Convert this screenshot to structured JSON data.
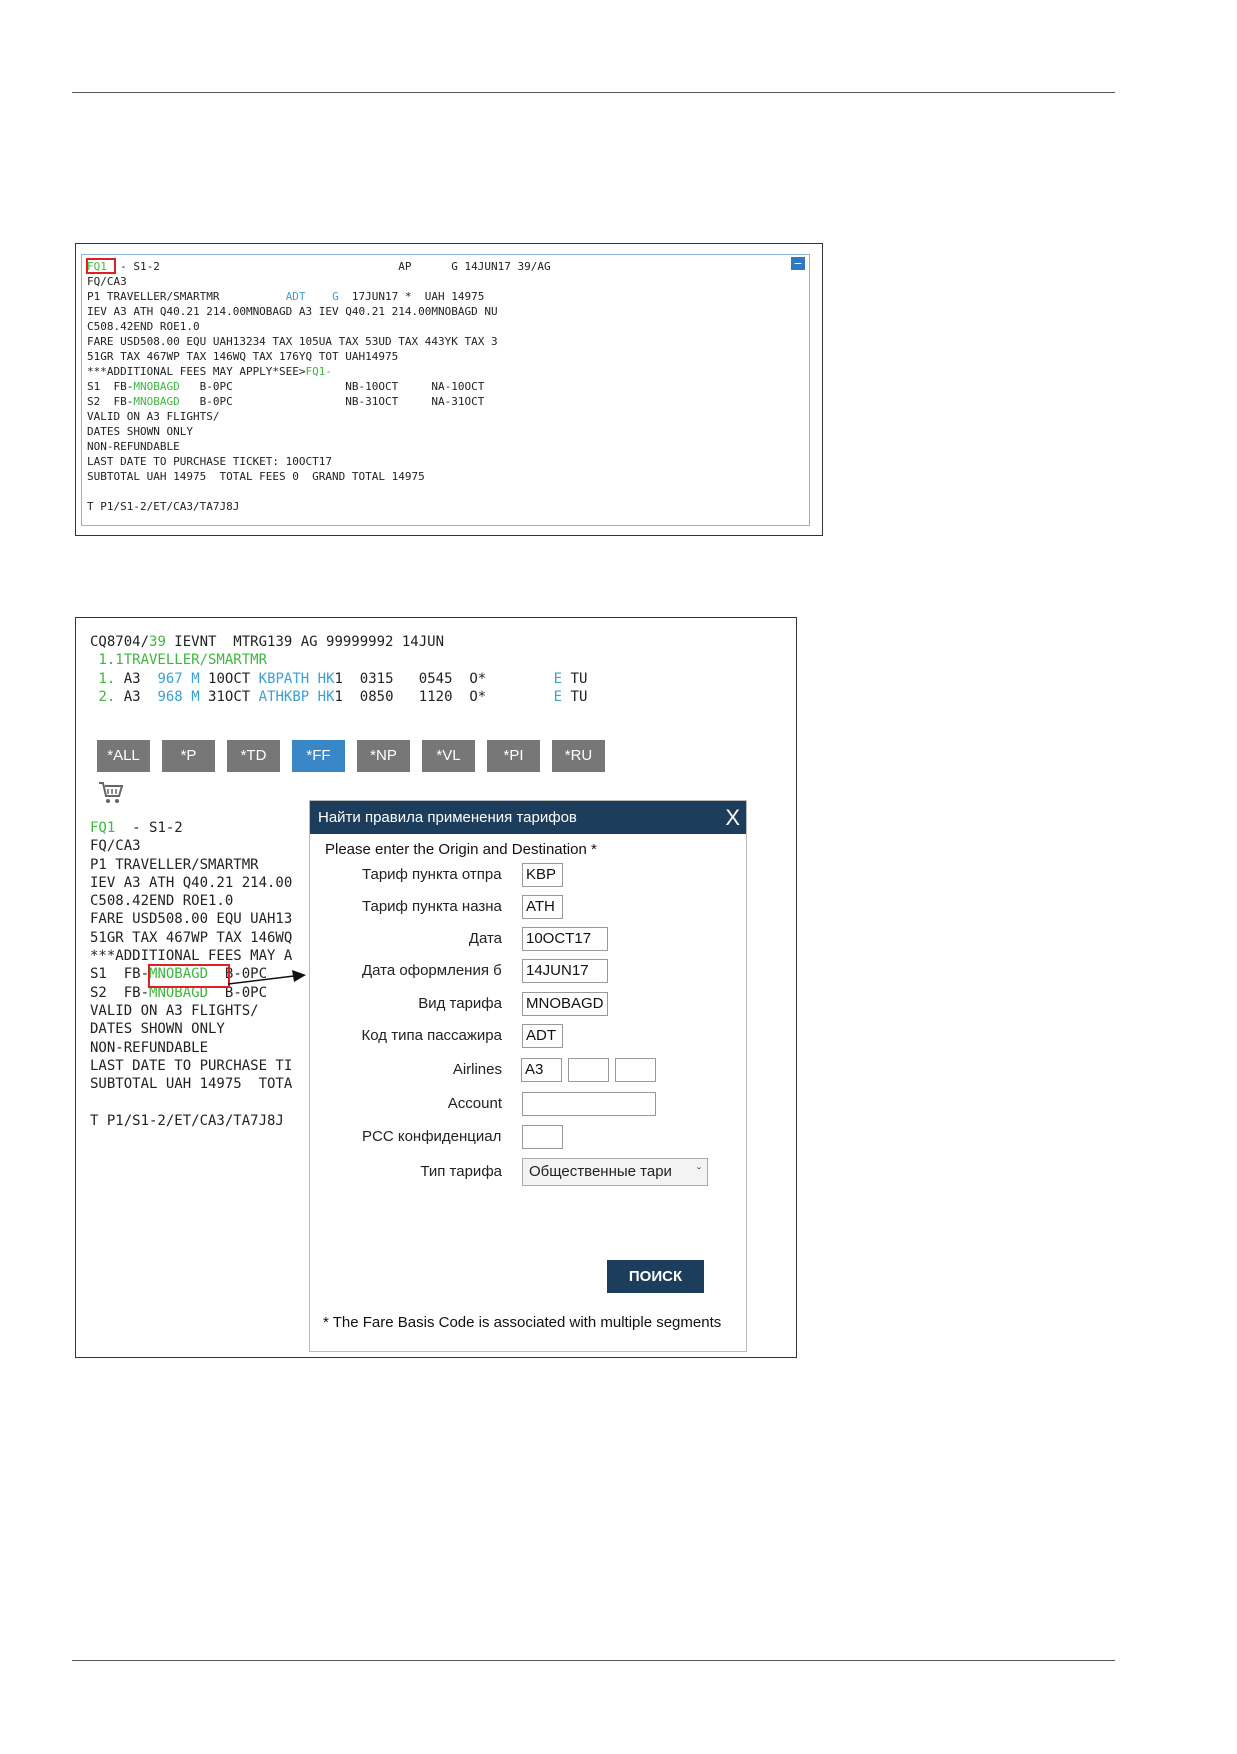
{
  "screen1": {
    "header": {
      "fq": "FQ1",
      "rest": "  - S1-2                                    AP      G 14JUN17 39/AG"
    },
    "collapse_icon": "−",
    "line2": "FQ/CA3",
    "line3": {
      "a": "P1 TRAVELLER/SMARTMR          ",
      "adt": "ADT",
      "sp": "    ",
      "g": "G",
      "rest": "  17JUN17 *  UAH 14975"
    },
    "line4": "IEV A3 ATH Q40.21 214.00MNOBAGD A3 IEV Q40.21 214.00MNOBAGD NU",
    "line5": "C508.42END ROE1.0",
    "line6": "FARE USD508.00 EQU UAH13234 TAX 105UA TAX 53UD TAX 443YK TAX 3",
    "line7": "51GR TAX 467WP TAX 146WQ TAX 176YQ TOT UAH14975",
    "line8": {
      "a": "***ADDITIONAL FEES MAY APPLY*SEE>",
      "link": "FQ1-"
    },
    "line9": {
      "a": "S1  FB-",
      "fb": "MNOBAGD",
      "b": "   B-0PC                 NB-10OCT     NA-10OCT"
    },
    "line10": {
      "a": "S2  FB-",
      "fb": "MNOBAGD",
      "b": "   B-0PC                 NB-31OCT     NA-31OCT"
    },
    "line11": "VALID ON A3 FLIGHTS/",
    "line12": "DATES SHOWN ONLY",
    "line13": "NON-REFUNDABLE",
    "line14": "LAST DATE TO PURCHASE TICKET: 10OCT17",
    "line15": "SUBTOTAL UAH 14975  TOTAL FEES 0  GRAND TOTAL 14975",
    "line16": "T P1/S1-2/ET/CA3/TA7J8J"
  },
  "screen2": {
    "pnr_line": {
      "a": "CQ8704/",
      "num": "39",
      "b": " IEVNT  MTRG139 AG 99999992 14JUN"
    },
    "pax_line": " 1.1TRAVELLER/SMARTMR",
    "seg1": {
      "n": " 1.",
      "a": " A3  ",
      "flt": "967",
      "sp": " ",
      "cls": "M",
      "date": " 10OCT ",
      "route": "KBPATH",
      "sp2": " ",
      "st": "HK",
      "b": "1  0315   0545  O*        ",
      "e": "E",
      "c": " TU"
    },
    "seg2": {
      "n": " 2.",
      "a": " A3  ",
      "flt": "968",
      "sp": " ",
      "cls": "M",
      "date": " 31OCT ",
      "route": "ATHKBP",
      "sp2": " ",
      "st": "HK",
      "b": "1  0850   1120  O*        ",
      "e": "E",
      "c": " TU"
    },
    "tabs": [
      "*ALL",
      "*P",
      "*TD",
      "*FF",
      "*NP",
      "*VL",
      "*PI",
      "*RU"
    ],
    "active_tab": "*FF",
    "cart_icon": "shopping-cart",
    "lines": {
      "l1a": "FQ1",
      "l1b": "  - S1-2",
      "l2": "FQ/CA3",
      "l3": "P1 TRAVELLER/SMARTMR",
      "l4": "IEV A3 ATH Q40.21 214.00",
      "l5": "C508.42END ROE1.0",
      "l6": "FARE USD508.00 EQU UAH13",
      "l7": "51GR TAX 467WP TAX 146WQ",
      "l8": "***ADDITIONAL FEES MAY A",
      "l9a": "S1  FB-",
      "l9fb": "MNOBAGD",
      "l9b": "  B-0PC",
      "l10a": "S2  FB-",
      "l10fb": "MNOBAGD",
      "l10b": "  B-0PC",
      "l11": "VALID ON A3 FLIGHTS/",
      "l12": "DATES SHOWN ONLY",
      "l13": "NON-REFUNDABLE",
      "l14": "LAST DATE TO PURCHASE TI",
      "l15": "SUBTOTAL UAH 14975  TOTA",
      "l16": "T P1/S1-2/ET/CA3/TA7J8J"
    },
    "dialog": {
      "title": "Найти правила применения тарифов",
      "close": "X",
      "intro": "Please enter the Origin and Destination *",
      "fields": {
        "origin_label": "Тариф пункта отправ",
        "origin_value": "KBP",
        "dest_label": "Тариф пункта назначе",
        "dest_value": "ATH",
        "date_label": "Дата",
        "date_value": "10OCT17",
        "issue_label": "Дата оформления би/",
        "issue_value": "14JUN17",
        "fare_label": "Вид тарифа",
        "fare_value": "MNOBAGD",
        "ptc_label": "Код типа пассажира",
        "ptc_value": "ADT",
        "airlines_label": "Airlines",
        "airline1": "A3",
        "airline2": "",
        "airline3": "",
        "account_label": "Account",
        "account_value": "",
        "pcc_label": "PCC конфиденциальн",
        "pcc_value": "",
        "type_label": "Тип тарифа",
        "type_value": "Общественные тари"
      },
      "search_button": "ПОИСК",
      "note": "* The Fare Basis Code is associated with multiple segments"
    }
  }
}
